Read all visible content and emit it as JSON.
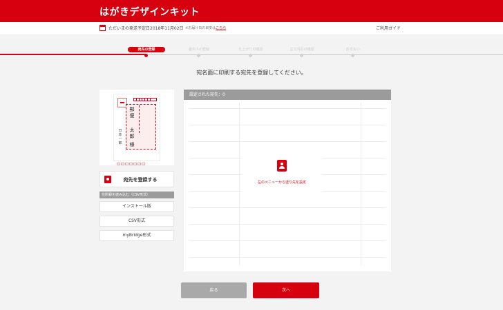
{
  "app": {
    "title": "はがきデザインキット"
  },
  "infobar": {
    "ship_label": "ただいまの発送予定日",
    "ship_date": "2018年11月02日",
    "note_prefix": "※お届け日の目安は",
    "note_link": "こちら",
    "guide": "ご利用ガイド"
  },
  "stepper": {
    "steps": [
      {
        "label": "宛先の登録",
        "active": true
      },
      {
        "label": "差出人の登録",
        "active": false
      },
      {
        "label": "仕上がりの確認",
        "active": false
      },
      {
        "label": "注文内容の確認",
        "active": false
      },
      {
        "label": "お支払い",
        "active": false
      }
    ]
  },
  "main": {
    "heading": "宛名面に印刷する宛先を登録してください。"
  },
  "preview": {
    "recipient_name_1": "郵便",
    "recipient_name_2": "太郎",
    "honorific": "様",
    "sender_name": "日本 一郎"
  },
  "sidebar": {
    "register_label": "宛先を登録する",
    "import_heading": "住所録を読み込む（CSV形式）",
    "import_buttons": [
      "インストール版",
      "CSV形式",
      "myBridge形式"
    ]
  },
  "list": {
    "header": "設定された宛先：0",
    "empty_message": "左のメニューから送り先を設定"
  },
  "footer": {
    "back_label": "戻る",
    "next_label": "次へ"
  },
  "colors": {
    "accent": "#d7000f",
    "gray": "#9b9b9b"
  }
}
